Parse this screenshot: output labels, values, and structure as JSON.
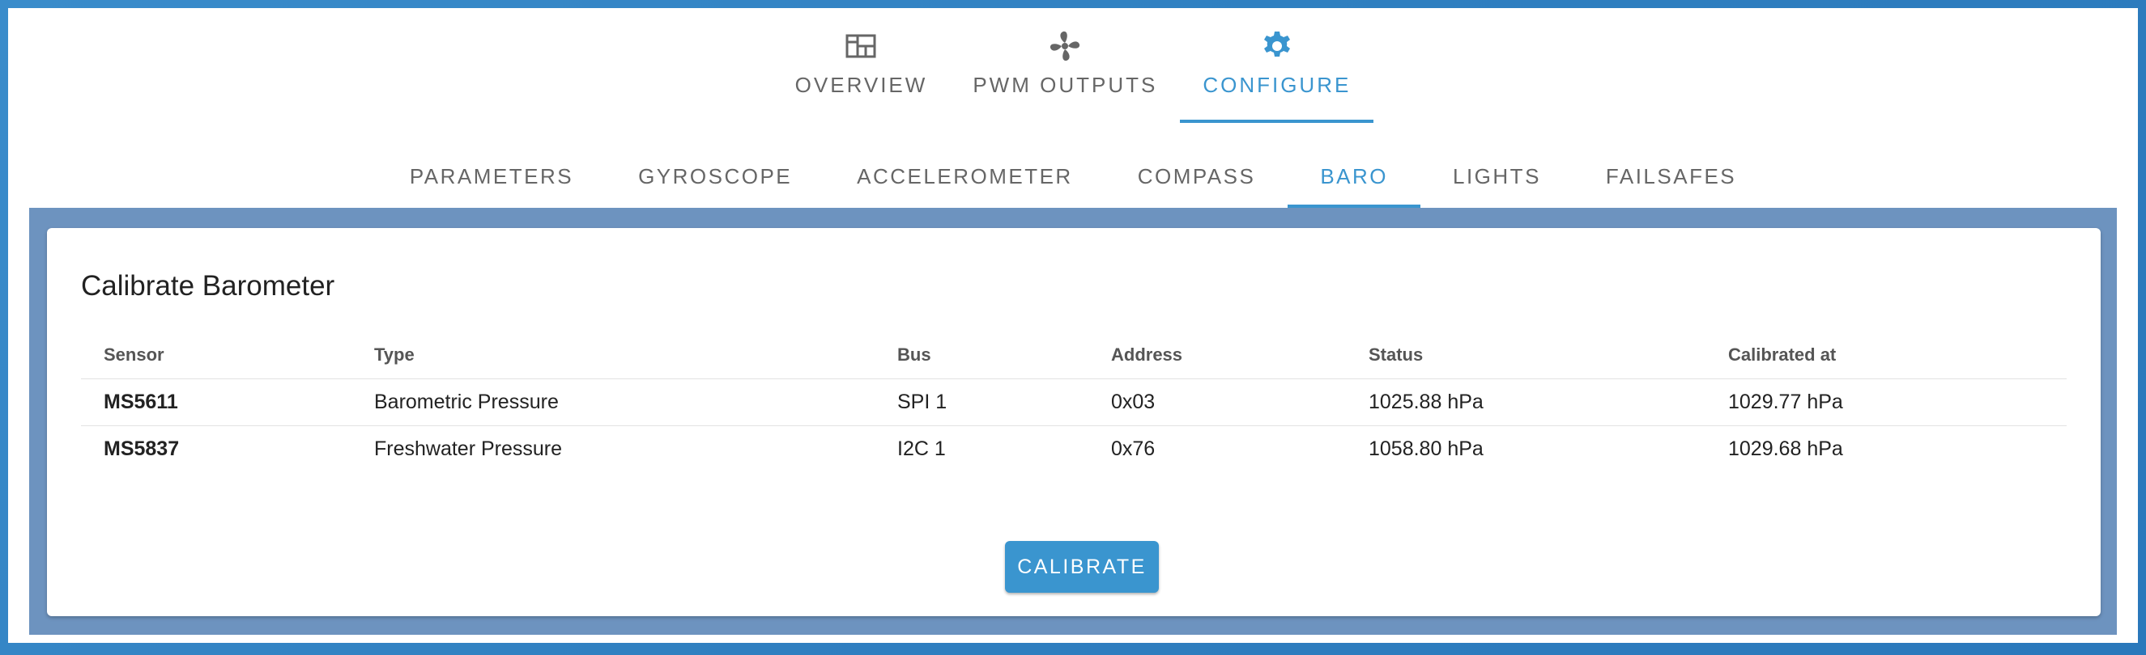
{
  "top_tabs": [
    {
      "label": "OVERVIEW",
      "icon": "dashboard-icon",
      "active": false
    },
    {
      "label": "PWM OUTPUTS",
      "icon": "fan-icon",
      "active": false
    },
    {
      "label": "CONFIGURE",
      "icon": "gear-icon",
      "active": true
    }
  ],
  "sub_tabs": [
    {
      "label": "PARAMETERS",
      "active": false
    },
    {
      "label": "GYROSCOPE",
      "active": false
    },
    {
      "label": "ACCELEROMETER",
      "active": false
    },
    {
      "label": "COMPASS",
      "active": false
    },
    {
      "label": "BARO",
      "active": true
    },
    {
      "label": "LIGHTS",
      "active": false
    },
    {
      "label": "FAILSAFES",
      "active": false
    }
  ],
  "card": {
    "title": "Calibrate Barometer",
    "table": {
      "headers": [
        "Sensor",
        "Type",
        "Bus",
        "Address",
        "Status",
        "Calibrated at"
      ],
      "rows": [
        [
          "MS5611",
          "Barometric Pressure",
          "SPI 1",
          "0x03",
          "1025.88 hPa",
          "1029.77 hPa"
        ],
        [
          "MS5837",
          "Freshwater Pressure",
          "I2C 1",
          "0x76",
          "1058.80 hPa",
          "1029.68 hPa"
        ]
      ]
    },
    "calibrate_label": "CALIBRATE"
  },
  "colors": {
    "accent": "#3a95cf",
    "content_background": "#6d93bf",
    "inactive_text": "#666666"
  }
}
